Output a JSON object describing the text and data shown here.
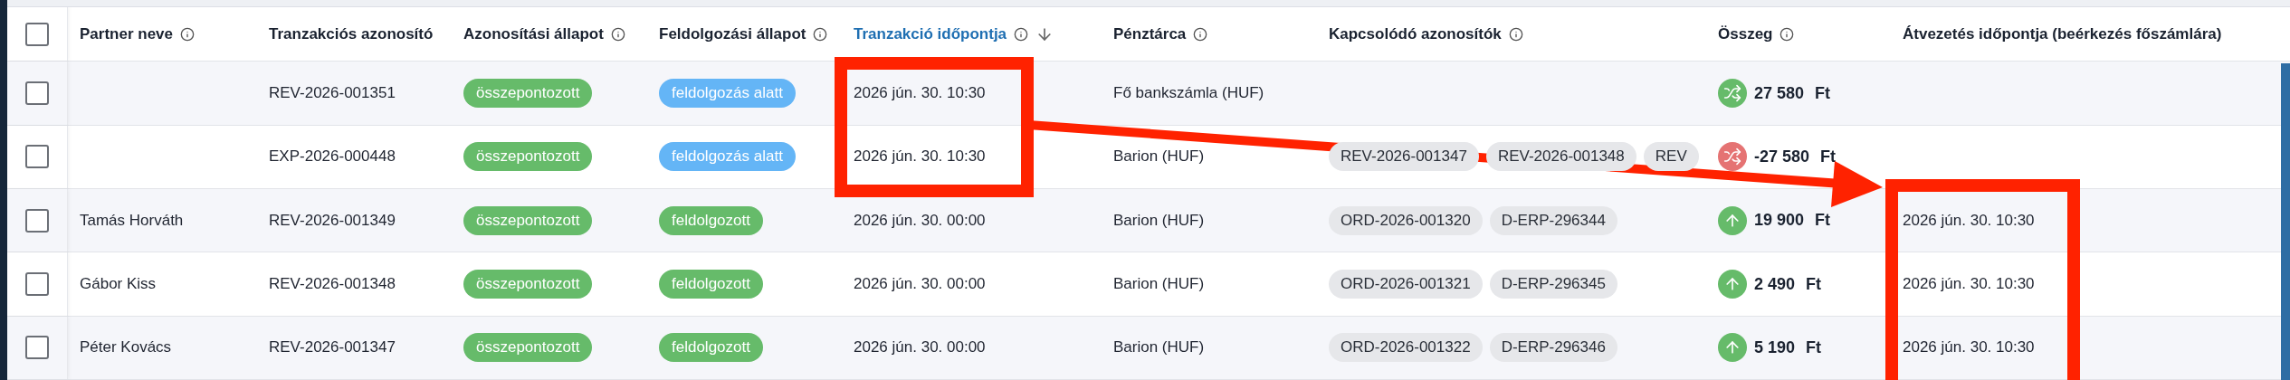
{
  "table": {
    "select_all": {
      "checked": false
    },
    "columns": [
      {
        "label": "Partner neve",
        "info": true,
        "sorted": false
      },
      {
        "label": "Tranzakciós azonosító",
        "sorted": false
      },
      {
        "label": "Azonosítási állapot",
        "info": true,
        "sorted": false
      },
      {
        "label": "Feldolgozási állapot",
        "info": true,
        "sorted": false
      },
      {
        "label": "Tranzakció időpontja",
        "info": true,
        "sorted": true
      },
      {
        "label": "Pénztárca",
        "info": true,
        "sorted": false
      },
      {
        "label": "Kapcsolódó azonosítók",
        "info": true,
        "sorted": false
      },
      {
        "label": "Összeg",
        "info": true,
        "sorted": false
      },
      {
        "label": "Átvezetés időpontja (beérkezés főszámlára)",
        "sorted": false
      }
    ],
    "rows": [
      {
        "checked": false,
        "transaction_id": "REV-2026-001351",
        "identification": {
          "label": "összepontozott",
          "color": "#66bb6a"
        },
        "processing": {
          "label": "feldolgozás alatt",
          "color": "#64b5f6"
        },
        "time": "2026 jún. 30. 10:30",
        "wallet": "Fő bankszámla (HUF)",
        "related_ids": [],
        "amount": {
          "kind": "transfer",
          "color": "#66bb6a",
          "value": "27 580",
          "currency": "Ft"
        }
      },
      {
        "checked": false,
        "transaction_id": "EXP-2026-000448",
        "identification": {
          "label": "összepontozott",
          "color": "#66bb6a"
        },
        "processing": {
          "label": "feldolgozás alatt",
          "color": "#64b5f6"
        },
        "time": "2026 jún. 30. 10:30",
        "wallet": "Barion (HUF)",
        "related_ids": [
          "REV-2026-001347",
          "REV-2026-001348",
          "REV"
        ],
        "amount": {
          "kind": "transfer",
          "color": "#e57373",
          "value": "-27 580",
          "currency": "Ft"
        }
      },
      {
        "checked": false,
        "partner": "Tamás Horváth",
        "transaction_id": "REV-2026-001349",
        "identification": {
          "label": "összepontozott",
          "color": "#66bb6a"
        },
        "processing": {
          "label": "feldolgozott",
          "color": "#66bb6a"
        },
        "time": "2026 jún. 30. 00:00",
        "wallet": "Barion (HUF)",
        "related_ids": [
          "ORD-2026-001320",
          "D-ERP-296344"
        ],
        "amount": {
          "kind": "incoming",
          "color": "#66bb6a",
          "value": "19 900",
          "currency": "Ft"
        },
        "transfer_time": "2026 jún. 30. 10:30"
      },
      {
        "checked": false,
        "partner": "Gábor Kiss",
        "transaction_id": "REV-2026-001348",
        "identification": {
          "label": "összepontozott",
          "color": "#66bb6a"
        },
        "processing": {
          "label": "feldolgozott",
          "color": "#66bb6a"
        },
        "time": "2026 jún. 30. 00:00",
        "wallet": "Barion (HUF)",
        "related_ids": [
          "ORD-2026-001321",
          "D-ERP-296345"
        ],
        "amount": {
          "kind": "incoming",
          "color": "#66bb6a",
          "value": "2 490",
          "currency": "Ft"
        },
        "transfer_time": "2026 jún. 30. 10:30"
      },
      {
        "checked": false,
        "partner": "Péter Kovács",
        "transaction_id": "REV-2026-001347",
        "identification": {
          "label": "összepontozott",
          "color": "#66bb6a"
        },
        "processing": {
          "label": "feldolgozott",
          "color": "#66bb6a"
        },
        "time": "2026 jún. 30. 00:00",
        "wallet": "Barion (HUF)",
        "related_ids": [
          "ORD-2026-001322",
          "D-ERP-296346"
        ],
        "amount": {
          "kind": "incoming",
          "color": "#66bb6a",
          "value": "5 190",
          "currency": "Ft"
        },
        "transfer_time": "2026 jún. 30. 10:30"
      }
    ]
  }
}
